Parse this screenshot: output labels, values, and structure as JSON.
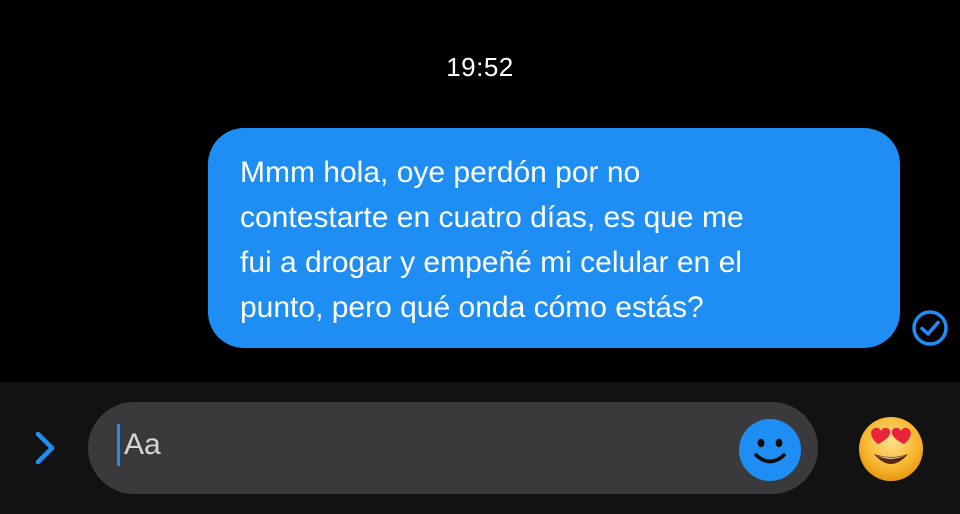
{
  "conversation": {
    "timestamp": "19:52",
    "messages": [
      {
        "sender": "me",
        "text": "Mmm hola, oye perdón por no\ncontestarte en cuatro días, es que me\nfui a drogar  y empeñé mi celular en el\npunto, pero qué onda cómo estás?",
        "status_icon": "read-check-icon"
      }
    ]
  },
  "composer": {
    "placeholder": "Aa",
    "value": "",
    "expand_icon": "chevron-right-icon",
    "sticker_icon": "smiley-icon",
    "quick_reaction_icon": "heart-eyes-emoji-icon"
  },
  "colors": {
    "background": "#000000",
    "bubble": "#1e8ef5",
    "accent": "#1e8ef5",
    "composer_bar": "#121212",
    "input_bg": "#3a3a3c"
  }
}
